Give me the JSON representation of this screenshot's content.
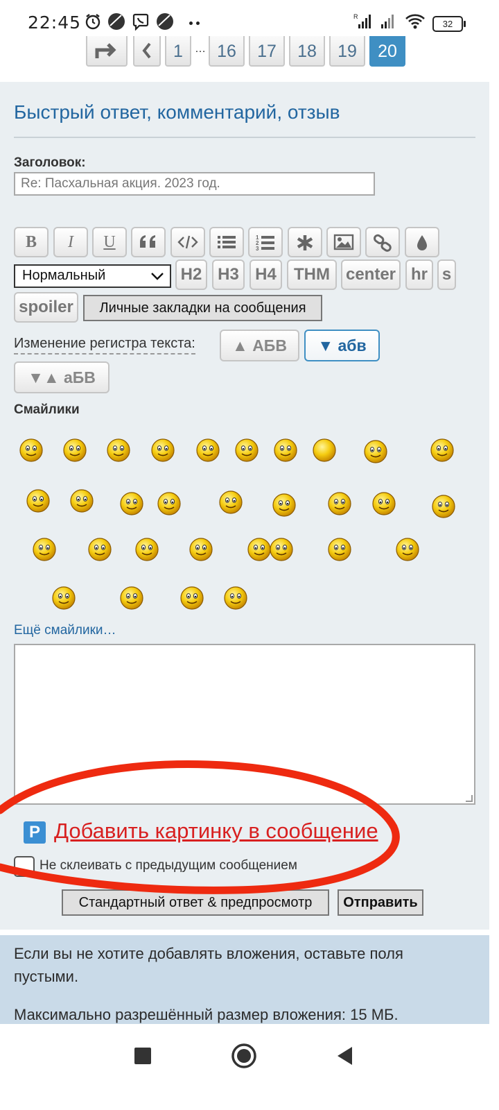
{
  "status_bar": {
    "time": "22:45",
    "battery": "32",
    "icons": [
      "alarm-icon",
      "app-icon",
      "viber-icon",
      "app-icon",
      "more-dots-icon",
      "signal-icon",
      "signal-icon",
      "wifi-icon",
      "battery-icon"
    ]
  },
  "pagination": {
    "pages": [
      "1",
      "…",
      "16",
      "17",
      "18",
      "19",
      "20"
    ],
    "current": "20"
  },
  "reply": {
    "title": "Быстрый ответ, комментарий, отзыв",
    "subject_label": "Заголовок:",
    "subject_value": "Re: Пасхальная акция. 2023 год."
  },
  "toolbar": {
    "buttons": [
      "B",
      "I",
      "U",
      "quote-icon",
      "code-icon",
      "list-icon",
      "numbered-list-icon",
      "asterisk-icon",
      "image-icon",
      "link-icon",
      "color-drop-icon"
    ],
    "font_size_select": "Нормальный",
    "tags": [
      "H2",
      "H3",
      "H4",
      "THM",
      "center",
      "hr",
      "s",
      "spoiler"
    ],
    "bookmarks_button": "Личные закладки на сообщения"
  },
  "case_change": {
    "label": "Изменение регистра текста:",
    "upper": "▲ АБВ",
    "lower": "▼ абв",
    "toggle": "▼▲ аБВ"
  },
  "smilies": {
    "label": "Смайлики",
    "more": "Ещё смайлики…",
    "count": 31
  },
  "attachments": {
    "add_picture": "Добавить картинку в сообщение",
    "no_merge_label": "Не склеивать с предыдущим сообщением"
  },
  "actions": {
    "preview": "Стандартный ответ & предпросмотр",
    "submit": "Отправить"
  },
  "info": {
    "line1": "Если вы не хотите добавлять вложения, оставьте поля пустыми.",
    "line2": "Максимально разрешённый размер вложения: 15 МБ."
  },
  "colors": {
    "accent": "#3f8fc3",
    "title_blue": "#2266a0",
    "panel": "#eaeff2",
    "info_bg": "#c9dae8",
    "annotation_red": "#ee2a10"
  }
}
